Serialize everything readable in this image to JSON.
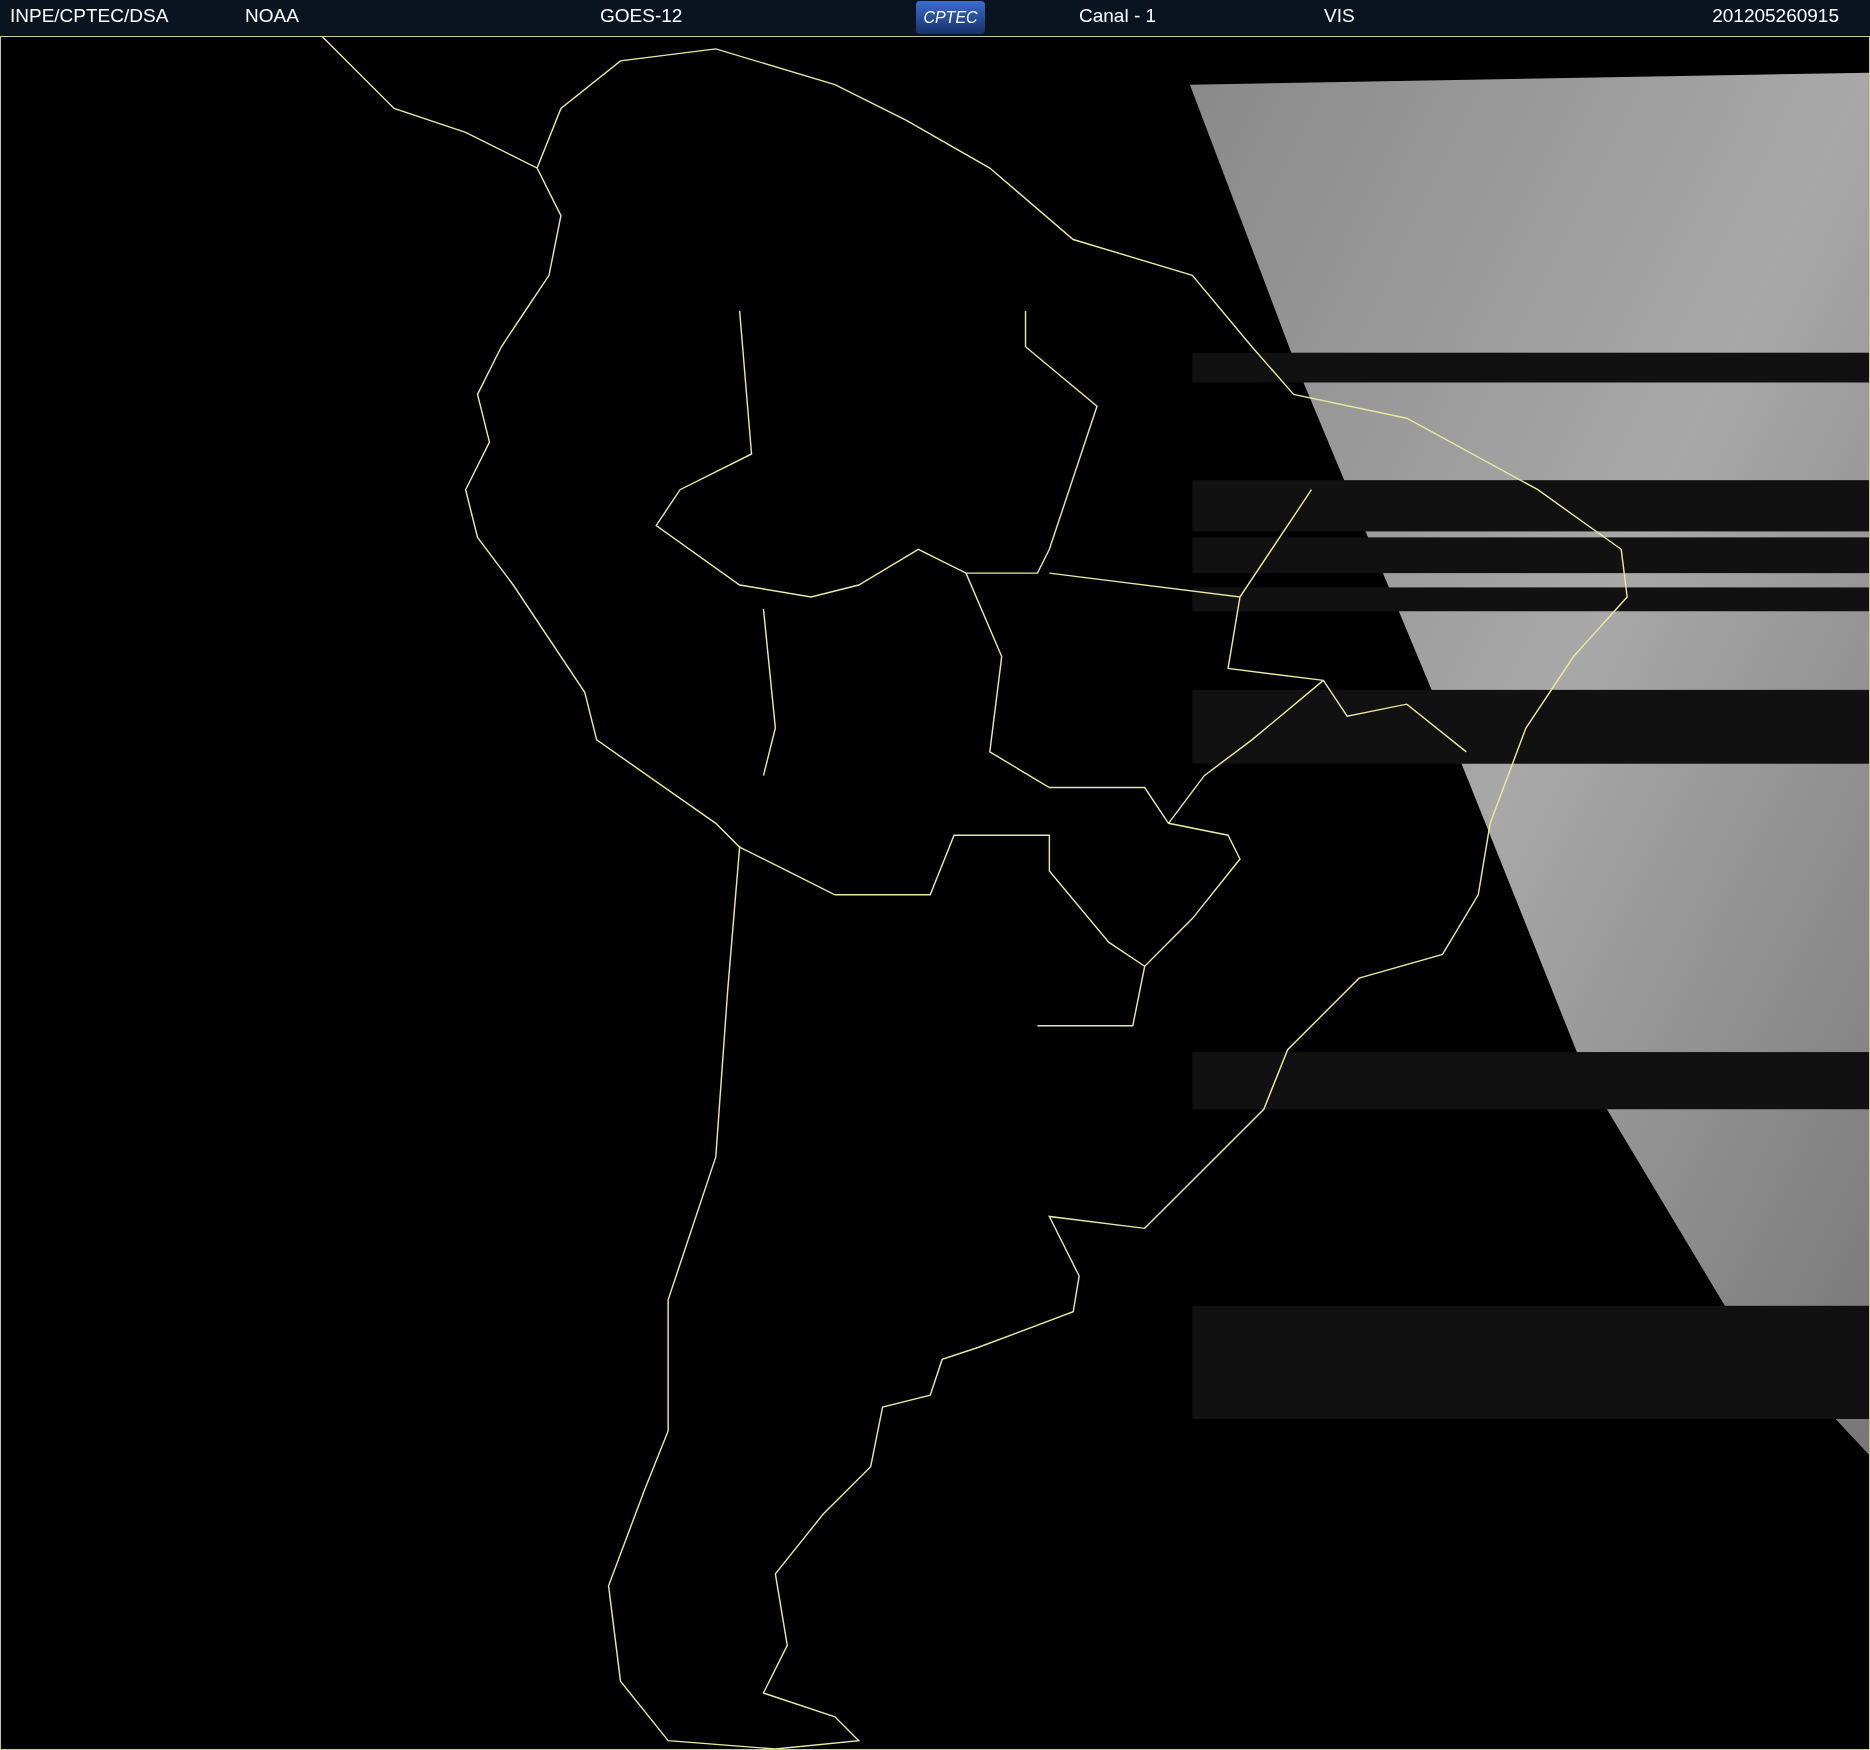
{
  "header": {
    "source": "INPE/CPTEC/DSA",
    "agency": "NOAA",
    "satellite": "GOES-12",
    "logo": "CPTEC",
    "channel": "Canal - 1",
    "band": "VIS",
    "timestamp": "201205260915"
  }
}
